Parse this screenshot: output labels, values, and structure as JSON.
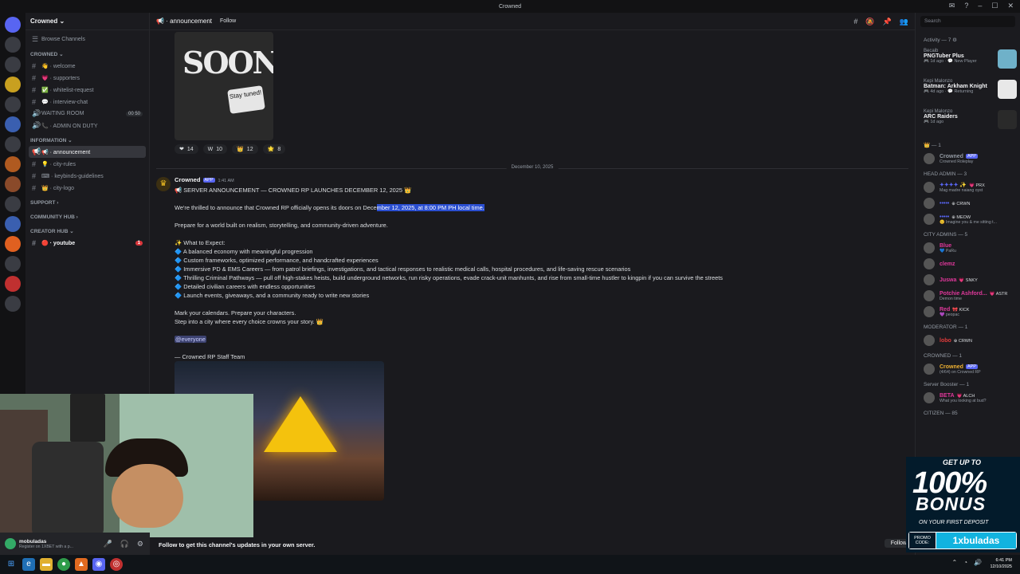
{
  "window": {
    "title": "Crowned"
  },
  "server": {
    "name": "Crowned ⌄",
    "browse": "Browse Channels"
  },
  "channels": {
    "cat_crowned": "CROWNED ⌄",
    "welcome": "👋 · welcome",
    "supporters": "💗 · supporters",
    "whitelist": "✅ · whitelist-request",
    "interview": "💬 · interview-chat",
    "waiting": "WAITING ROOM",
    "waiting_badge": "00  50",
    "admin": "📞 · ADMIN ON DUTY",
    "cat_information": "INFORMATION ⌄",
    "announcement": "📢 · announcement",
    "rules": "💡 · city-rules",
    "keybinds": "⌨ · keybinds-guidelines",
    "logo": "👑 · city-logo",
    "cat_support": "SUPPORT ›",
    "cat_community": "COMMUNITY HUB ›",
    "cat_creator": "CREATOR HUB ⌄",
    "youtube": "🔴 · youtube",
    "youtube_badge": "1"
  },
  "topbar": {
    "channel": "📢 · announcement",
    "follow": "Follow"
  },
  "prev_message": {
    "soon_text": "SOON",
    "stay_tuned": "Stay tuned!",
    "reactions": [
      {
        "emoji": "❤",
        "count": "14"
      },
      {
        "emoji": "W",
        "count": "10"
      },
      {
        "emoji": "👑",
        "count": "12"
      },
      {
        "emoji": "🌟",
        "count": "8"
      }
    ]
  },
  "date_divider": "December 10, 2025",
  "message": {
    "author": "Crowned",
    "app_tag": "APP",
    "time": "1:41 AM",
    "headline": "📢 SERVER ANNOUNCEMENT — CROWNED RP LAUNCHES DECEMBER 12, 2025 👑",
    "line1_pre": "We're thrilled to announce that Crowned RP officially opens its doors on Dece",
    "line1_hl": "mber 12, 2025, at 8:00 PM PH local time.",
    "line2": "Prepare for a world built on realism, storytelling, and community-driven adventure.",
    "expect_title": "✨ What to Expect:",
    "bullets": [
      "🔷 A balanced economy with meaningful progression",
      "🔷 Custom frameworks, optimized performance, and handcrafted experiences",
      "🔷 Immersive PD & EMS Careers — from patrol briefings, investigations, and tactical responses to realistic medical calls, hospital procedures, and life-saving rescue scenarios",
      "🔷 Thrilling Criminal Pathways — pull off high-stakes heists, build underground networks, run risky operations, evade crack-unit manhunts, and rise from small-time hustler to kingpin if you can survive the streets",
      "🔷 Detailed civilian careers with endless opportunities",
      "🔷 Launch events, giveaways, and a community ready to write new stories"
    ],
    "cta1": "Mark your calendars. Prepare your characters.",
    "cta2": "Step into a city where every choice crowns your story. 👑",
    "mention": "@everyone",
    "signoff": "— Crowned RP Staff Team"
  },
  "follow_bar": {
    "text": "Follow to get this channel's updates in your own server.",
    "button": "Follow"
  },
  "right": {
    "search_placeholder": "Search",
    "activity_title": "Activity — 7 ⚙",
    "activities": [
      {
        "user": "Becaib",
        "game": "PNGTuber Plus",
        "meta": "🎮 1d ago · 💬 New Player",
        "color": "#6fb1c9"
      },
      {
        "user": "Kepi Malonzo",
        "game": "Batman: Arkham Knight",
        "meta": "🎮 4d ago · 💬 Returning",
        "color": "#e8e8e8"
      },
      {
        "user": "Kepi Malonzo",
        "game": "ARC Raiders",
        "meta": "🎮 1d ago",
        "color": "#2a2a2a"
      }
    ],
    "groups": [
      {
        "title": "👑 — 1",
        "members": [
          {
            "name": "Crowned",
            "tag": "APP",
            "sub": "Crowned Roleplay",
            "color": "#949ba4"
          }
        ]
      },
      {
        "title": "HEAD ADMIN — 3",
        "members": [
          {
            "name": "✦✦✦✦ ✨",
            "tag": "💗 PRX",
            "sub": "Mag madre naiang oyst",
            "color": "#5865f2"
          },
          {
            "name": "•••••",
            "tag": "⊕ CRWN",
            "sub": "",
            "color": "#5865f2"
          },
          {
            "name": "•••••",
            "tag": "⊕ MEOW",
            "sub": "😊 Imagine you & me sitting t...",
            "color": "#5865f2"
          }
        ]
      },
      {
        "title": "CITY ADMINS — 5",
        "members": [
          {
            "name": "Blue",
            "tag": "",
            "sub": "💙 PaRu",
            "color": "#e0389b"
          },
          {
            "name": "clemz",
            "tag": "",
            "sub": "",
            "color": "#e0389b"
          },
          {
            "name": "Juswa",
            "tag": "💗 SNKY",
            "sub": "",
            "color": "#e0389b"
          },
          {
            "name": "Potchie Ashford...",
            "tag": "💗 ASTR",
            "sub": "Demon time",
            "color": "#e0389b"
          },
          {
            "name": "Red",
            "tag": "🎀 KICK",
            "sub": "💜 peopac",
            "color": "#e0389b"
          }
        ]
      },
      {
        "title": "MODERATOR — 1",
        "members": [
          {
            "name": "lobo",
            "tag": "⊕ CRWN",
            "sub": "",
            "color": "#e23b3b"
          }
        ]
      },
      {
        "title": "CROWNED — 1",
        "members": [
          {
            "name": "Crowned",
            "tag": "APP",
            "sub": "(4/64) on Crowned RP",
            "color": "#f0b232"
          }
        ]
      },
      {
        "title": "Server Booster — 1",
        "members": [
          {
            "name": "BETA",
            "tag": "💗 ALCH",
            "sub": "What you looking at bud?",
            "color": "#e0389b"
          }
        ]
      },
      {
        "title": "CITIZEN — 85",
        "members": []
      }
    ]
  },
  "user": {
    "name": "mobuladas",
    "status": "Register on 1XBET with a p..."
  },
  "promo": {
    "line1": "GET UP TO",
    "big": "100%",
    "bonus": "BONUS",
    "sub": "ON YOUR FIRST DEPOSIT",
    "code_label": "PROMO CODE:",
    "code": "1xbuladas"
  },
  "taskbar": {
    "time": "6:41 PM",
    "date": "12/10/2025"
  }
}
